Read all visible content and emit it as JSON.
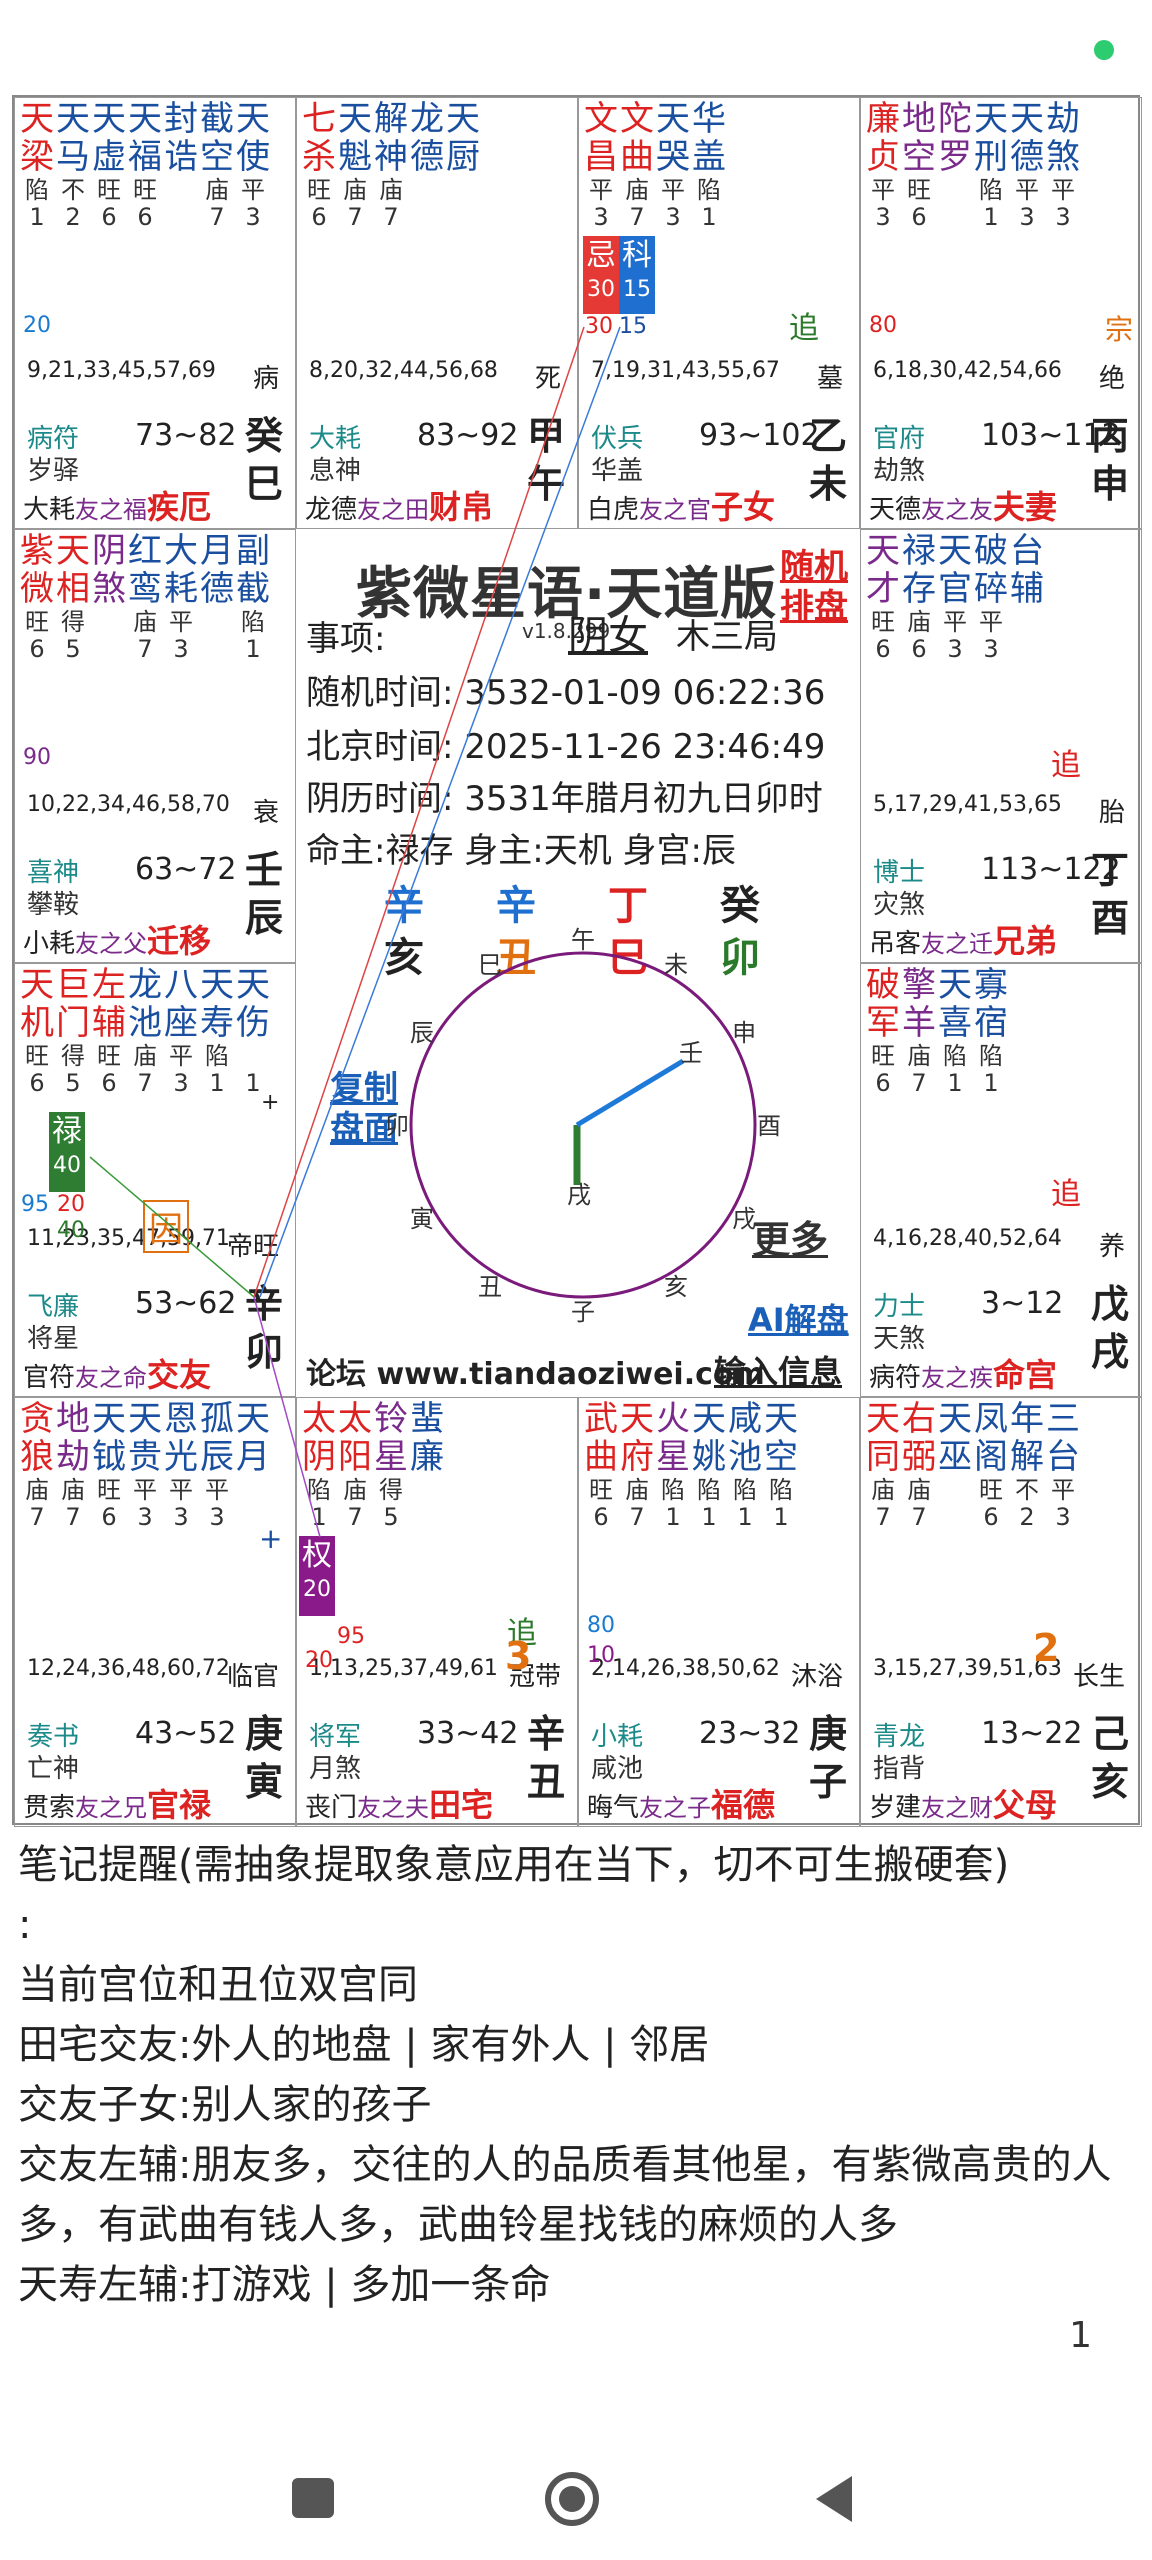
{
  "palaces": {
    "si": {
      "stars": [
        {
          "n": "天梁",
          "c": "r",
          "b": "陷",
          "num": "1"
        },
        {
          "n": "天马",
          "c": "bl",
          "b": "不",
          "num": "2"
        },
        {
          "n": "天虚",
          "c": "bl",
          "b": "旺",
          "num": "6"
        },
        {
          "n": "天福",
          "c": "bl",
          "b": "旺",
          "num": "6"
        },
        {
          "n": "封诰",
          "c": "bl",
          "b": "",
          "num": ""
        },
        {
          "n": "截空",
          "c": "bl",
          "b": "庙",
          "num": "7"
        },
        {
          "n": "天使",
          "c": "bl",
          "b": "平",
          "num": "3"
        }
      ],
      "extra": "20",
      "ages": "9,21,33,45,57,69",
      "stage": "病",
      "god1": "病符",
      "god2": "岁驿",
      "range": "73~82",
      "stem": "癸",
      "branch": "巳",
      "b1": "大耗",
      "b2": "友之福",
      "palace": "疾厄"
    },
    "wu": {
      "stars": [
        {
          "n": "七杀",
          "c": "r",
          "b": "旺",
          "num": "6"
        },
        {
          "n": "天魁",
          "c": "bl",
          "b": "庙",
          "num": "7"
        },
        {
          "n": "解神",
          "c": "bl",
          "b": "庙",
          "num": "7"
        },
        {
          "n": "龙德",
          "c": "bl",
          "b": "",
          "num": ""
        },
        {
          "n": "天厨",
          "c": "bl",
          "b": "",
          "num": ""
        }
      ],
      "ages": "8,20,32,44,56,68",
      "stage": "死",
      "god1": "大耗",
      "god2": "息神",
      "range": "83~92",
      "stem": "甲",
      "branch": "午",
      "b1": "龙德",
      "b2": "友之田",
      "palace": "财帛"
    },
    "wei": {
      "stars": [
        {
          "n": "文昌",
          "c": "r",
          "b": "平",
          "num": "3"
        },
        {
          "n": "文曲",
          "c": "r",
          "b": "庙",
          "num": "7"
        },
        {
          "n": "天哭",
          "c": "bl",
          "b": "平",
          "num": "3"
        },
        {
          "n": "华盖",
          "c": "bl",
          "b": "陷",
          "num": "1"
        }
      ],
      "tag1": "忌",
      "tag1n": "30",
      "tag2": "科",
      "tag2n": "15",
      "tagsub1": "30",
      "tagsub2": "15",
      "chase": "追",
      "ages": "7,19,31,43,55,67",
      "stage": "墓",
      "god1": "伏兵",
      "god2": "华盖",
      "range": "93~102",
      "stem": "乙",
      "branch": "未",
      "b1": "白虎",
      "b2": "友之官",
      "palace": "子女"
    },
    "shen": {
      "stars": [
        {
          "n": "廉贞",
          "c": "r",
          "b": "平",
          "num": "3"
        },
        {
          "n": "地空",
          "c": "pu",
          "b": "旺",
          "num": "6"
        },
        {
          "n": "陀罗",
          "c": "pu",
          "b": "",
          "num": ""
        },
        {
          "n": "天刑",
          "c": "bl",
          "b": "陷",
          "num": "1"
        },
        {
          "n": "天德",
          "c": "bl",
          "b": "平",
          "num": "3"
        },
        {
          "n": "劫煞",
          "c": "bl",
          "b": "平",
          "num": "3"
        }
      ],
      "extra": "80",
      "zong": "宗",
      "ages": "6,18,30,42,54,66",
      "stage": "绝",
      "god1": "官府",
      "god2": "劫煞",
      "range": "103~112",
      "stem": "丙",
      "branch": "申",
      "b1": "天德",
      "b2": "友之友",
      "palace": "夫妻"
    },
    "chen": {
      "stars": [
        {
          "n": "紫微",
          "c": "r",
          "b": "旺",
          "num": "6"
        },
        {
          "n": "天相",
          "c": "r",
          "b": "得",
          "num": "5"
        },
        {
          "n": "阴煞",
          "c": "pu",
          "b": "",
          "num": ""
        },
        {
          "n": "红鸾",
          "c": "bl",
          "b": "庙",
          "num": "7"
        },
        {
          "n": "大耗",
          "c": "bl",
          "b": "平",
          "num": "3"
        },
        {
          "n": "月德",
          "c": "bl",
          "b": "",
          "num": ""
        },
        {
          "n": "副截",
          "c": "bl",
          "b": "陷",
          "num": "1"
        }
      ],
      "extra": "90",
      "ages": "10,22,34,46,58,70",
      "stage": "衰",
      "god1": "喜神",
      "god2": "攀鞍",
      "range": "63~72",
      "stem": "壬",
      "branch": "辰",
      "b1": "小耗",
      "b2": "友之父",
      "palace": "迁移"
    },
    "you": {
      "stars": [
        {
          "n": "天才",
          "c": "pu",
          "b": "旺",
          "num": "6"
        },
        {
          "n": "禄存",
          "c": "bl",
          "b": "庙",
          "num": "6"
        },
        {
          "n": "天官",
          "c": "bl",
          "b": "平",
          "num": "3"
        },
        {
          "n": "破碎",
          "c": "bl",
          "b": "平",
          "num": "3"
        },
        {
          "n": "台辅",
          "c": "bl",
          "b": "",
          "num": ""
        }
      ],
      "chase": "追",
      "ages": "5,17,29,41,53,65",
      "stage": "胎",
      "god1": "博士",
      "god2": "灾煞",
      "range": "113~122",
      "stem": "丁",
      "branch": "酉",
      "b1": "吊客",
      "b2": "友之迁",
      "palace": "兄弟"
    },
    "mao": {
      "stars": [
        {
          "n": "天机",
          "c": "r",
          "b": "旺",
          "num": "6"
        },
        {
          "n": "巨门",
          "c": "r",
          "b": "得",
          "num": "5"
        },
        {
          "n": "左辅",
          "c": "r",
          "b": "旺",
          "num": "6"
        },
        {
          "n": "龙池",
          "c": "bl",
          "b": "庙",
          "num": "7"
        },
        {
          "n": "八座",
          "c": "bl",
          "b": "平",
          "num": "3"
        },
        {
          "n": "天寿",
          "c": "bl",
          "b": "陷",
          "num": "1"
        },
        {
          "n": "天伤",
          "c": "bl",
          "b": "",
          "num": "1"
        }
      ],
      "tag1": "禄",
      "tag1n": "40",
      "yin": "因",
      "n95": "95",
      "n20": "20",
      "n40": "40",
      "plus": "+",
      "ages": "11,23,35,47,59,71",
      "stage": "帝旺",
      "god1": "飞廉",
      "god2": "将星",
      "range": "53~62",
      "stem": "辛",
      "branch": "卯",
      "b1": "官符",
      "b2": "友之命",
      "palace": "交友"
    },
    "xu": {
      "stars": [
        {
          "n": "破军",
          "c": "r",
          "b": "旺",
          "num": "6"
        },
        {
          "n": "擎羊",
          "c": "pu",
          "b": "庙",
          "num": "7"
        },
        {
          "n": "天喜",
          "c": "bl",
          "b": "陷",
          "num": "1"
        },
        {
          "n": "寡宿",
          "c": "bl",
          "b": "陷",
          "num": "1"
        }
      ],
      "chase": "追",
      "ages": "4,16,28,40,52,64",
      "stage": "养",
      "god1": "力士",
      "god2": "天煞",
      "range": "3~12",
      "stem": "戊",
      "branch": "戌",
      "b1": "病符",
      "b2": "友之疾",
      "palace": "命宫"
    },
    "yin": {
      "stars": [
        {
          "n": "贪狼",
          "c": "r",
          "b": "庙",
          "num": "7"
        },
        {
          "n": "地劫",
          "c": "pu",
          "b": "庙",
          "num": "7"
        },
        {
          "n": "天钺",
          "c": "bl",
          "b": "旺",
          "num": "6"
        },
        {
          "n": "天贵",
          "c": "bl",
          "b": "平",
          "num": "3"
        },
        {
          "n": "恩光",
          "c": "bl",
          "b": "平",
          "num": "3"
        },
        {
          "n": "孤辰",
          "c": "bl",
          "b": "平",
          "num": "3"
        },
        {
          "n": "天月",
          "c": "bl",
          "b": "",
          "num": ""
        }
      ],
      "plus": "+",
      "ages": "12,24,36,48,60,72",
      "stage": "临官",
      "god1": "奏书",
      "god2": "亡神",
      "range": "43~52",
      "stem": "庚",
      "branch": "寅",
      "b1": "贯索",
      "b2": "友之兄",
      "palace": "官禄"
    },
    "chou": {
      "stars": [
        {
          "n": "太阴",
          "c": "r",
          "b": "陷",
          "num": "1"
        },
        {
          "n": "太阳",
          "c": "r",
          "b": "庙",
          "num": "7"
        },
        {
          "n": "铃星",
          "c": "pu",
          "b": "得",
          "num": "5"
        },
        {
          "n": "蜚廉",
          "c": "bl",
          "b": "",
          "num": ""
        }
      ],
      "tag1": "权",
      "tag1n": "20",
      "n95": "95",
      "n20": "20",
      "chase": "追",
      "three": "3",
      "ages": "1,13,25,37,49,61",
      "stage": "冠带",
      "god1": "将军",
      "god2": "月煞",
      "range": "33~42",
      "stem": "辛",
      "branch": "丑",
      "b1": "丧门",
      "b2": "友之夫",
      "palace": "田宅"
    },
    "zi": {
      "stars": [
        {
          "n": "武曲",
          "c": "r",
          "b": "旺",
          "num": "6"
        },
        {
          "n": "天府",
          "c": "r",
          "b": "庙",
          "num": "7"
        },
        {
          "n": "火星",
          "c": "pu",
          "b": "陷",
          "num": "1"
        },
        {
          "n": "天姚",
          "c": "bl",
          "b": "陷",
          "num": "1"
        },
        {
          "n": "咸池",
          "c": "bl",
          "b": "陷",
          "num": "1"
        },
        {
          "n": "天空",
          "c": "bl",
          "b": "陷",
          "num": "1"
        }
      ],
      "n80": "80",
      "n10": "10",
      "ages": "2,14,26,38,50,62",
      "stage": "沐浴",
      "god1": "小耗",
      "god2": "咸池",
      "range": "23~32",
      "stem": "庚",
      "branch": "子",
      "b1": "晦气",
      "b2": "友之子",
      "palace": "福德"
    },
    "hai": {
      "stars": [
        {
          "n": "天同",
          "c": "r",
          "b": "庙",
          "num": "7"
        },
        {
          "n": "右弼",
          "c": "r",
          "b": "庙",
          "num": "7"
        },
        {
          "n": "天巫",
          "c": "bl",
          "b": "",
          "num": ""
        },
        {
          "n": "凤阁",
          "c": "bl",
          "b": "旺",
          "num": "6"
        },
        {
          "n": "年解",
          "c": "bl",
          "b": "不",
          "num": "2"
        },
        {
          "n": "三台",
          "c": "bl",
          "b": "平",
          "num": "3"
        }
      ],
      "two": "2",
      "ages": "3,15,27,39,51,63",
      "stage": "长生",
      "god1": "青龙",
      "god2": "指背",
      "range": "13~22",
      "stem": "己",
      "branch": "亥",
      "b1": "岁建",
      "b2": "友之财",
      "palace": "父母"
    }
  },
  "center": {
    "title": "紫微星语·天道版",
    "version": "v1.8.299",
    "random_label": "随机排盘",
    "matter_label": "事项:",
    "gender": "阴女",
    "ju": "木三局",
    "random_time": "随机时间:  3532-01-09 06:22:36",
    "beijing_time": "北京时间:  2025-11-26 23:46:49",
    "lunar_time": "阴历时间:  3531年腊月初九日卯时",
    "ming_zhu": "命主:禄存 身主:天机 身宫:辰",
    "gan": [
      "辛",
      "辛",
      "丁",
      "癸"
    ],
    "zhi": [
      "亥",
      "丑",
      "巳",
      "卯"
    ],
    "copy": "复制盘面",
    "more": "更多",
    "ai": "AI解盘",
    "forum": "论坛 www.tiandaoziwei.com",
    "input": "输入信息",
    "clock_branches": [
      "巳",
      "午",
      "未",
      "申",
      "酉",
      "戌",
      "亥",
      "子",
      "丑",
      "寅",
      "卯",
      "辰"
    ],
    "clock_center": "戌",
    "clock_ren": "壬"
  },
  "notes": {
    "title": "笔记提醒(需抽象提取象意应用在当下，切不可生搬硬套)",
    "colon": ":",
    "lines": [
      "当前宫位和丑位双宫同",
      "田宅交友:外人的地盘 | 家有外人 | 邻居",
      "交友子女:别人家的孩子",
      "交友左辅:朋友多，交往的人的品质看其他星，有紫微高贵的人多，有武曲有钱人多，武曲铃星找钱的麻烦的人多",
      "天寿左辅:打游戏 | 多加一条命"
    ]
  },
  "page_number": "1",
  "colors": {
    "red": "#d22",
    "blue": "#1a4fa0",
    "purple": "#7a2a8a",
    "green": "#2b7a2b",
    "orange": "#e07010"
  }
}
